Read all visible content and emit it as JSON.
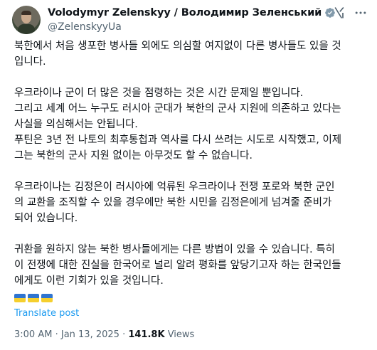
{
  "author": {
    "display_name": "Volodymyr Zelenskyy / Володимир Зеленський",
    "handle": "@ZelenskyyUa"
  },
  "tweet": {
    "paragraphs": [
      [
        "북한에서 처음 생포한 병사들 외에도 의심할 여지없이 다른 병사들도 있을 것",
        "입니다."
      ],
      [
        "우크라이나 군이 더 많은 것을 점령하는 것은 시간 문제일 뿐입니다.",
        "그리고 세계 어느 누구도 러시아 군대가 북한의 군사 지원에 의존하고 있다는",
        "사실을 의심해서는 안됩니다.",
        "푸틴은 3년 전 나토의 최후통첩과 역사를 다시 쓰려는 시도로 시작했고, 이제",
        "그는 북한의 군사 지원 없이는 아무것도 할 수 없습니다."
      ],
      [
        "우크라이나는 김정은이 러시아에 억류된 우크라이나 전쟁 포로와 북한 군인",
        "의 교환을 조직할 수 있을 경우에만 북한 시민을 김정은에게 넘겨줄 준비가",
        "되어 있습니다."
      ],
      [
        "귀환을 원하지 않는 북한 병사들에게는 다른 방법이 있을 수 있습니다. 특히",
        "이 전쟁에 대한 진실을 한국어로 널리 알려 평화를 앞당기고자 하는 한국인들",
        "에게도 이런 기회가 있을 것입니다."
      ]
    ],
    "translate_label": "Translate post",
    "time": "3:00 AM",
    "separator": "·",
    "date": "Jan 13, 2025",
    "views_count": "141.8K",
    "views_label": "Views"
  },
  "icons": {
    "verified": "verified-badge-icon",
    "grok": "grok-icon",
    "more": "more-options-icon",
    "flags": [
      "ukraine-flag-icon",
      "ukraine-flag-icon",
      "ukraine-flag-icon"
    ]
  },
  "colors": {
    "text": "#0f1419",
    "secondary": "#536471",
    "link": "#1d9bf0",
    "flag_blue": "#2f74d0",
    "flag_yellow": "#f5cf2e"
  }
}
